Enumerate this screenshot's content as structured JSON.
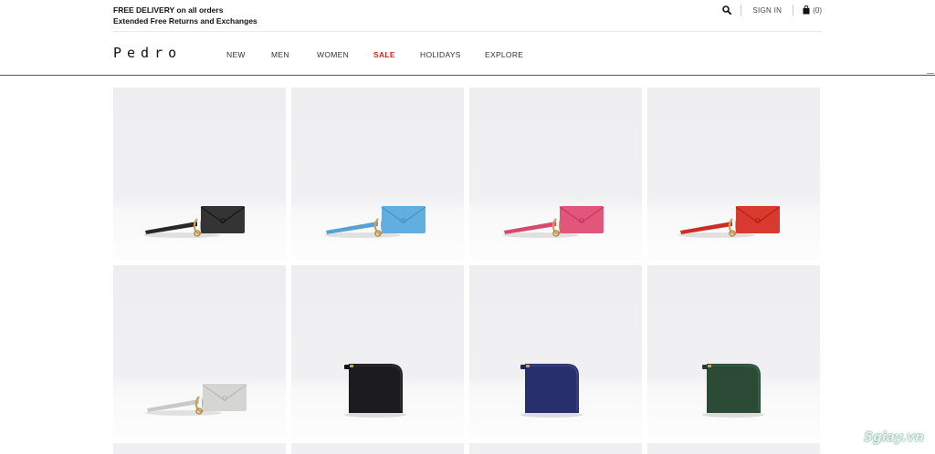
{
  "promo": {
    "line1": "FREE DELIVERY on all orders",
    "line2": "Extended Free Returns and Exchanges"
  },
  "utility": {
    "search_icon": "search-icon",
    "sign_in": "SIGN IN",
    "cart_icon": "shopping-bag-icon",
    "cart_count": "(0)"
  },
  "brand": {
    "logo": "Pedro"
  },
  "nav": {
    "items": [
      {
        "label": "NEW"
      },
      {
        "label": "MEN"
      },
      {
        "label": "WOMEN"
      },
      {
        "label": "SALE",
        "highlight": "#d42323"
      },
      {
        "label": "HOLIDAYS"
      },
      {
        "label": "EXPLORE"
      }
    ]
  },
  "products": [
    {
      "style": "envelope-card-holder",
      "color": "#343434"
    },
    {
      "style": "envelope-card-holder",
      "color": "#62aedf"
    },
    {
      "style": "envelope-card-holder",
      "color": "#e1567a"
    },
    {
      "style": "envelope-card-holder",
      "color": "#d83a2f"
    },
    {
      "style": "envelope-card-holder",
      "color": "#d5d6d3"
    },
    {
      "style": "zip-wallet",
      "color": "#1c1c1e"
    },
    {
      "style": "zip-wallet",
      "color": "#27306b"
    },
    {
      "style": "zip-wallet",
      "color": "#2b4b37"
    }
  ],
  "watermark": "5giay.vn"
}
